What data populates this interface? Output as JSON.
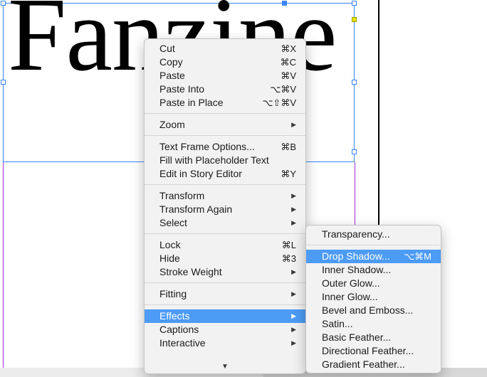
{
  "document": {
    "frame_text": "Fanzine"
  },
  "context_menu": {
    "groups": [
      [
        {
          "label": "Cut",
          "shortcut": "⌘X"
        },
        {
          "label": "Copy",
          "shortcut": "⌘C"
        },
        {
          "label": "Paste",
          "shortcut": "⌘V"
        },
        {
          "label": "Paste Into",
          "shortcut": "⌥⌘V"
        },
        {
          "label": "Paste in Place",
          "shortcut": "⌥⇧⌘V"
        }
      ],
      [
        {
          "label": "Zoom",
          "submenu": true
        }
      ],
      [
        {
          "label": "Text Frame Options...",
          "shortcut": "⌘B"
        },
        {
          "label": "Fill with Placeholder Text"
        },
        {
          "label": "Edit in Story Editor",
          "shortcut": "⌘Y"
        }
      ],
      [
        {
          "label": "Transform",
          "submenu": true
        },
        {
          "label": "Transform Again",
          "submenu": true
        },
        {
          "label": "Select",
          "submenu": true
        }
      ],
      [
        {
          "label": "Lock",
          "shortcut": "⌘L"
        },
        {
          "label": "Hide",
          "shortcut": "⌘3"
        },
        {
          "label": "Stroke Weight",
          "submenu": true
        }
      ],
      [
        {
          "label": "Fitting",
          "submenu": true
        }
      ],
      [
        {
          "label": "Effects",
          "submenu": true,
          "selected": true
        },
        {
          "label": "Captions",
          "submenu": true
        },
        {
          "label": "Interactive",
          "submenu": true
        }
      ]
    ],
    "arrow_glyph": "▶",
    "scroll_glyph": "▼"
  },
  "effects_menu": {
    "groups": [
      [
        {
          "label": "Transparency..."
        }
      ],
      [
        {
          "label": "Drop Shadow...",
          "shortcut": "⌥⌘M",
          "selected": true
        },
        {
          "label": "Inner Shadow..."
        },
        {
          "label": "Outer Glow..."
        },
        {
          "label": "Inner Glow..."
        },
        {
          "label": "Bevel and Emboss..."
        },
        {
          "label": "Satin..."
        },
        {
          "label": "Basic Feather..."
        },
        {
          "label": "Directional Feather..."
        },
        {
          "label": "Gradient Feather..."
        }
      ]
    ]
  },
  "colors": {
    "selection": "#4c9bf5",
    "frame_border": "#3c84f0",
    "margin_guide": "#a12bd8"
  }
}
